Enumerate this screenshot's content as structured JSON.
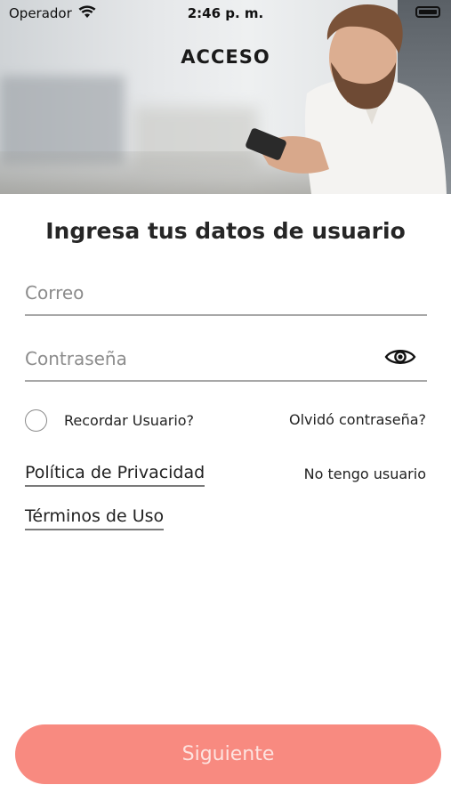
{
  "status_bar": {
    "carrier": "Operador",
    "time": "2:46 p. m."
  },
  "header": {
    "title": "ACCESO"
  },
  "form": {
    "title": "Ingresa tus datos de usuario",
    "email": {
      "placeholder": "Correo",
      "value": ""
    },
    "password": {
      "placeholder": "Contraseña",
      "value": ""
    },
    "remember_label": "Recordar Usuario?",
    "forgot_label": "Olvidó contraseña?",
    "privacy_label": "Política de Privacidad",
    "no_user_label": "No tengo usuario",
    "terms_label": "Términos de Uso",
    "next_label": "Siguiente"
  },
  "colors": {
    "accent": "#f88a80",
    "button_text": "#fde3df",
    "divider": "#a8a8a8"
  },
  "icons": {
    "wifi": "wifi-icon",
    "battery": "battery-icon",
    "password_toggle": "eye-icon",
    "remember": "radio-circle"
  }
}
